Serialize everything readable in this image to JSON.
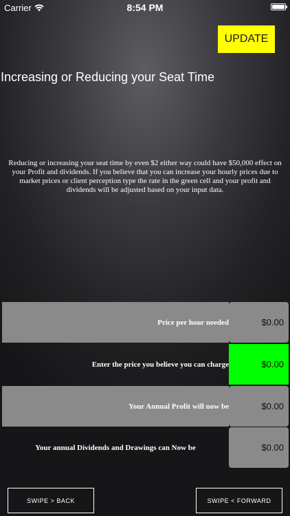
{
  "status_bar": {
    "carrier": "Carrier",
    "time": "8:54 PM"
  },
  "toolbar": {
    "update_label": "UPDATE"
  },
  "page": {
    "title": "Increasing or Reducing your Seat Time",
    "description": "Reducing or increasing your seat time by even $2 either way could have $50,000 effect on your Profit and dividends. If you believe that you can increase your hourly prices due to market prices or client perception type the rate in the green cell and your profit and dividends will be adjusted based on your input data."
  },
  "rows": [
    {
      "label": "Price per hour needed",
      "value": "$0.00"
    },
    {
      "label": "Enter the price you believe you can charge",
      "value": "$0.00"
    },
    {
      "label": "Your Annual Profit will now be",
      "value": "$0.00"
    },
    {
      "label": "Your annual Dividends and Drawings can Now be",
      "value": "$0.00"
    }
  ],
  "nav": {
    "back_label": "SWIPE > BACK",
    "forward_label": "SWIPE < FORWARD"
  },
  "colors": {
    "update_button": "#ffff00",
    "input_cell": "#00ff00",
    "cell_gray": "#8a8a8a"
  },
  "icons": [
    "wifi-icon",
    "battery-icon"
  ]
}
